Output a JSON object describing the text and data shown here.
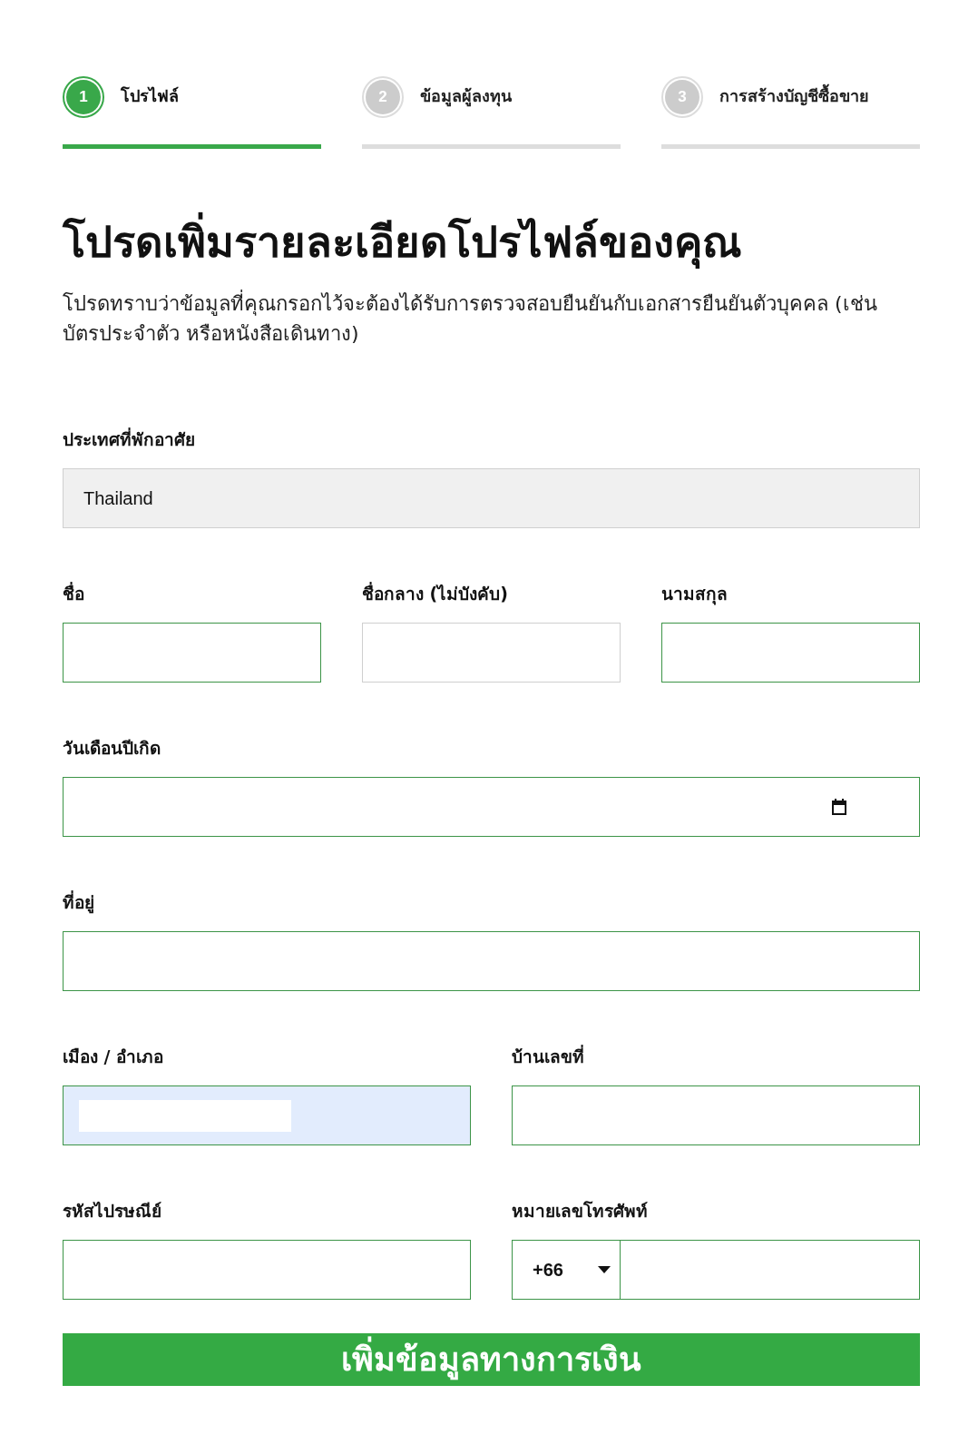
{
  "steps": [
    {
      "number": "1",
      "label": "โปรไฟล์",
      "selected": true
    },
    {
      "number": "2",
      "label": "ข้อมูลผู้ลงทุน",
      "selected": false
    },
    {
      "number": "3",
      "label": "การสร้างบัญชีซื้อขาย",
      "selected": false
    }
  ],
  "heading": "โปรดเพิ่มรายละเอียดโปรไฟล์ของคุณ",
  "intro": "โปรดทราบว่าข้อมูลที่คุณกรอกไว้จะต้องได้รับการตรวจสอบยืนยันกับเอกสารยืนยันตัวบุคคล (เช่น บัตรประจำตัว หรือหนังสือเดินทาง)",
  "form_rows": [
    {
      "fields": [
        {
          "kind": "text",
          "label": "ประเทศที่พักอาศัย",
          "value": "Thailand",
          "disabled": true,
          "valid": false,
          "autofilled": false
        }
      ]
    },
    {
      "fields": [
        {
          "kind": "text",
          "label": "ชื่อ",
          "disabled": false,
          "valid": true,
          "autofilled": false
        },
        {
          "kind": "text",
          "label": "ชื่อกลาง (ไม่บังคับ)",
          "disabled": false,
          "valid": false,
          "autofilled": false
        },
        {
          "kind": "text",
          "label": "นามสกุล",
          "disabled": false,
          "valid": true,
          "autofilled": false
        }
      ]
    },
    {
      "fields": [
        {
          "kind": "date",
          "label": "วันเดือนปีเกิด",
          "disabled": false,
          "valid": true,
          "autofilled": false
        }
      ]
    },
    {
      "fields": [
        {
          "kind": "text",
          "label": "ที่อยู่",
          "disabled": false,
          "valid": true,
          "autofilled": false
        }
      ]
    },
    {
      "fields": [
        {
          "kind": "text",
          "label": "เมือง / อำเภอ",
          "disabled": false,
          "valid": true,
          "autofilled": true
        },
        {
          "kind": "text",
          "label": "บ้านเลขที่",
          "disabled": false,
          "valid": true,
          "autofilled": false
        }
      ]
    },
    {
      "fields": [
        {
          "kind": "text",
          "label": "รหัสไปรษณีย์",
          "disabled": false,
          "valid": true,
          "autofilled": false
        },
        {
          "kind": "phone",
          "label": "หมายเลขโทรศัพท์",
          "code": "+66",
          "disabled": false,
          "valid": true,
          "autofilled": false
        }
      ]
    }
  ],
  "submit_button": "เพิ่มข้อมูลทางการเงิน"
}
